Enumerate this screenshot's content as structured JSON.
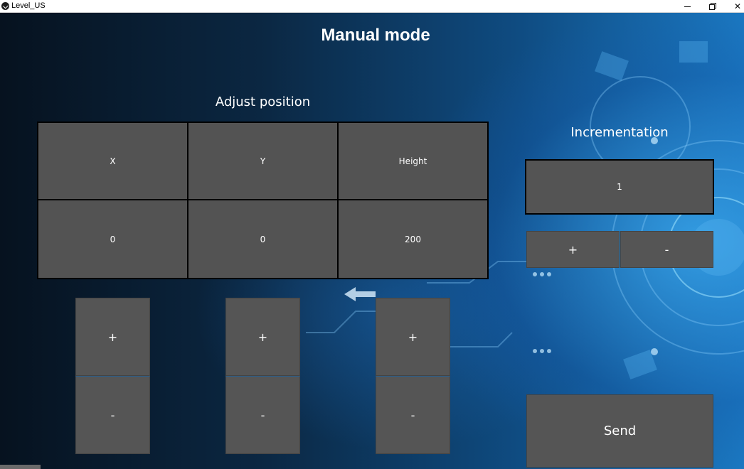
{
  "window": {
    "title": "Level_US",
    "minimize_icon": "minimize-icon",
    "maximize_icon": "restore-icon",
    "close_icon": "close-icon",
    "close_glyph": "✕"
  },
  "page": {
    "title": "Manual mode",
    "adjust_title": "Adjust position",
    "incrementation_title": "Incrementation"
  },
  "position_table": {
    "headers": [
      "X",
      "Y",
      "Height"
    ],
    "values": [
      "0",
      "0",
      "200"
    ]
  },
  "axis_buttons": {
    "plus_label": "+",
    "minus_label": "-"
  },
  "incrementation": {
    "value": "1",
    "plus_label": "+",
    "minus_label": "-"
  },
  "send_label": "Send",
  "colors": {
    "panel": "#545454",
    "text": "#ffffff",
    "accent_bg": "#1b79c2"
  }
}
